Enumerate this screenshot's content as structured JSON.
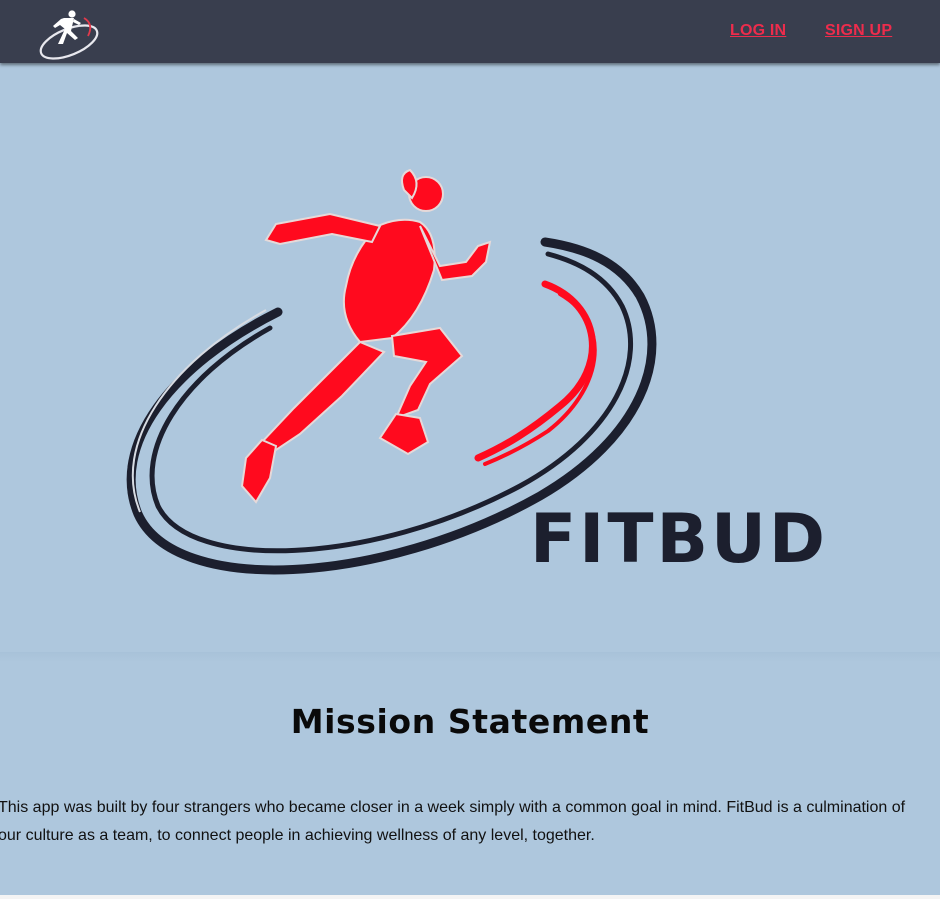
{
  "nav": {
    "logo_icon": "runner-logo-icon",
    "login_label": "LOG IN",
    "signup_label": "SIGN UP"
  },
  "hero": {
    "brand_name": "FITBUD",
    "logo_icon": "red-runner-logo-icon"
  },
  "mission": {
    "title": "Mission Statement",
    "body": "This app was built by four strangers who became closer in a week simply with a common goal in mind. FitBud is a culmination of our culture as a team, to connect people in achieving wellness of any level, together."
  },
  "colors": {
    "navbar_bg": "#393e4e",
    "nav_link": "#ee2c4c",
    "page_bg": "#aec7dd",
    "runner_red": "#ff0a1e",
    "swoosh_dark": "#1c1f2e"
  }
}
